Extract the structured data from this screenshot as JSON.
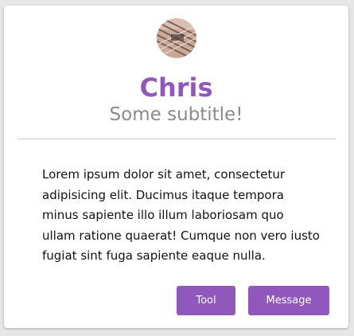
{
  "profile": {
    "name": "Chris",
    "subtitle": "Some subtitle!",
    "avatar_icon": "avatar-photo"
  },
  "content": {
    "body": "Lorem ipsum dolor sit amet, consectetur adipisicing elit. Ducimus itaque tempora minus sapiente illo illum laboriosam quo ullam ratione quaerat! Cumque non vero iusto fugiat sint fuga sapiente eaque nulla."
  },
  "actions": {
    "tool_label": "Tool",
    "message_label": "Message"
  },
  "colors": {
    "accent": "#9058bd",
    "subtitle": "#8a8a8a",
    "background": "#e6e6e6",
    "card": "#ffffff"
  }
}
